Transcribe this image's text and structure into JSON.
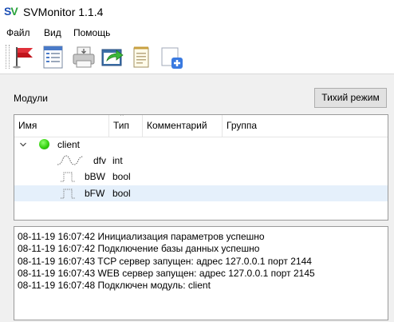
{
  "window": {
    "title": "SVMonitor 1.1.4",
    "logo_text_s": "S",
    "logo_text_v": "V"
  },
  "menu": {
    "items": [
      "Файл",
      "Вид",
      "Помощь"
    ]
  },
  "toolbar": {
    "buttons": [
      "flag-icon",
      "list-document-icon",
      "printer-icon",
      "export-arrow-icon",
      "notepad-icon",
      "add-window-icon"
    ]
  },
  "modules_panel": {
    "label": "Модули",
    "silent_mode_button": "Тихий режим",
    "columns": [
      "Имя",
      "Тип",
      "Комментарий",
      "Группа"
    ],
    "sort_column": "Тип",
    "nodes": [
      {
        "name": "client",
        "status": "connected",
        "status_color": "#35d10f",
        "expanded": true,
        "children": [
          {
            "name": "dfv",
            "type": "int",
            "icon": "analog-signal-icon"
          },
          {
            "name": "bBW",
            "type": "bool",
            "icon": "digital-signal-icon"
          },
          {
            "name": "bFW",
            "type": "bool",
            "icon": "digital-signal-icon",
            "selected": true
          }
        ]
      }
    ]
  },
  "log": {
    "lines": [
      "08-11-19 16:07:42 Инициализация параметров успешно",
      "08-11-19 16:07:42 Подключение базы данных успешно",
      "08-11-19 16:07:43 TCP сервер запущен: адрес 127.0.0.1 порт 2144",
      "08-11-19 16:07:43 WEB сервер запущен: адрес 127.0.0.1 порт 2145",
      "08-11-19 16:07:48 Подключен модуль: client"
    ]
  },
  "colors": {
    "selection": "#e5f0fb",
    "logo_blue": "#1d4fb5",
    "logo_green": "#2aa33b"
  }
}
